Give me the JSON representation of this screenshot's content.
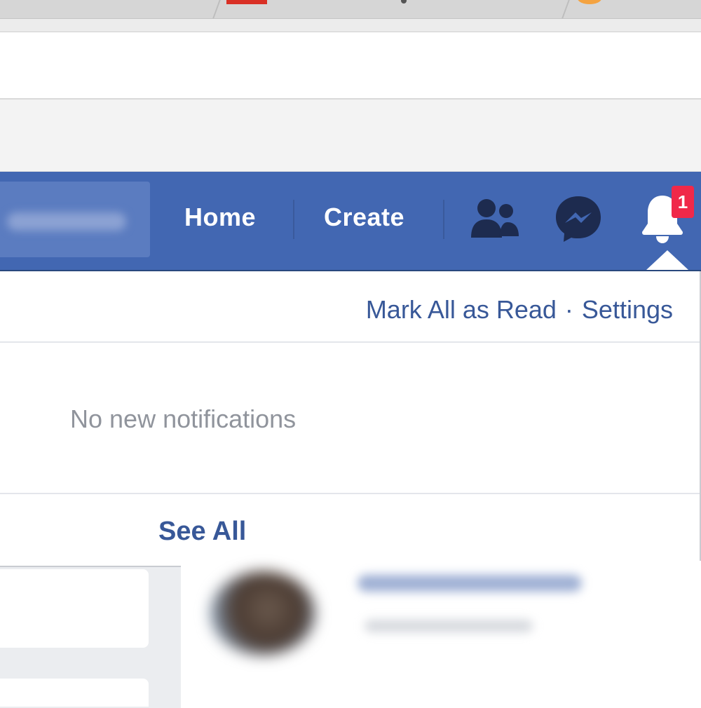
{
  "nav": {
    "home_label": "Home",
    "create_label": "Create",
    "icons": [
      "friends-icon",
      "messenger-icon",
      "bell-icon"
    ],
    "notifications_badge": "1"
  },
  "notifications": {
    "mark_all_label": "Mark All as Read",
    "separator": "·",
    "settings_label": "Settings",
    "empty_message": "No new notifications",
    "see_all_label": "See All"
  },
  "colors": {
    "brand_blue": "#4267b2",
    "link_blue": "#385898",
    "badge_red": "#f02849",
    "muted_text": "#90949c"
  }
}
